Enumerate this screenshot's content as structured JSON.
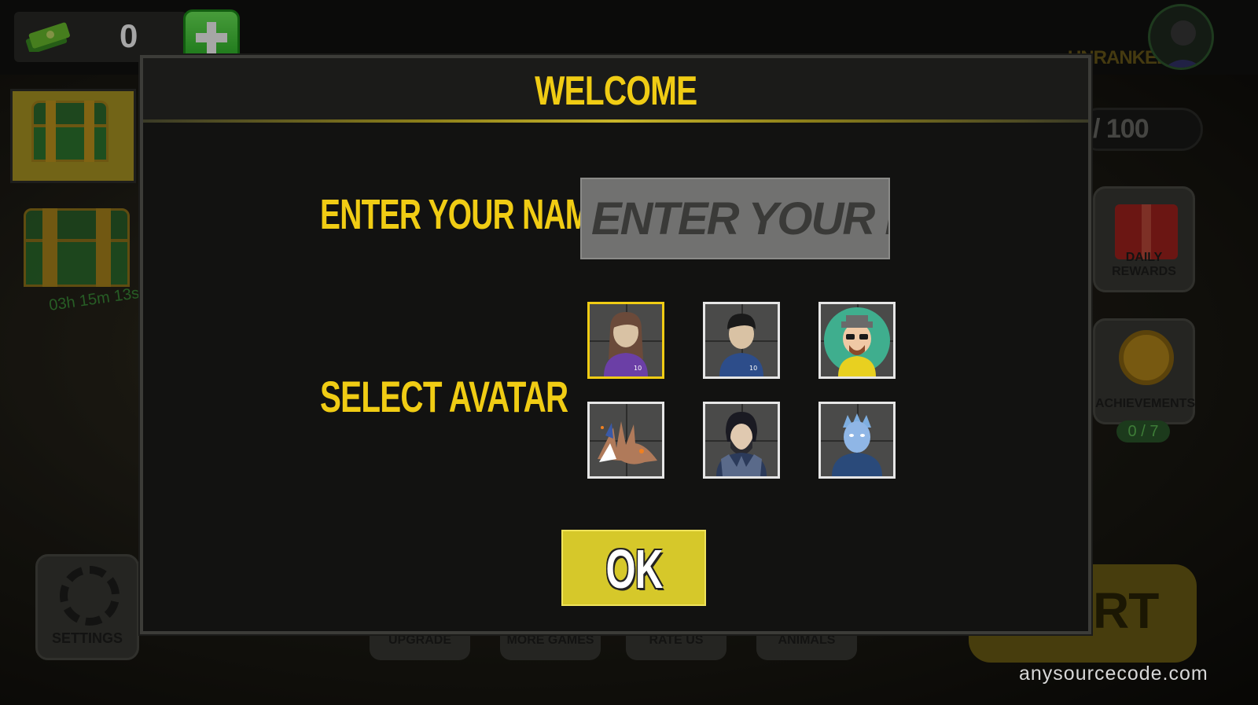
{
  "hud": {
    "cash_value": "0",
    "cash_icon": "money-stack-icon",
    "add_cash_icon": "plus-icon",
    "chest_timer": "03h 15m 13s",
    "rank_label": "UNRANKED",
    "xp_text": "/ 100",
    "daily_rewards_label": "DAILY REWARDS",
    "achievements_label": "ACHIEVEMENTS",
    "achievements_count": "0 / 7",
    "settings_label": "SETTINGS",
    "start_label": "RT",
    "bottom_tabs": [
      "UPGRADE",
      "MORE GAMES",
      "RATE US",
      "ANIMALS"
    ]
  },
  "dialog": {
    "title": "WELCOME",
    "name_label": "ENTER YOUR NAME",
    "name_placeholder": "ENTER YOUR NAME..",
    "name_value": "",
    "avatar_label": "SELECT AVATAR",
    "avatars": [
      {
        "name": "girl-avatar-icon",
        "selected": true
      },
      {
        "name": "boy-avatar-icon",
        "selected": false
      },
      {
        "name": "bald-man-glasses-avatar-icon",
        "selected": false
      },
      {
        "name": "dragon-avatar-icon",
        "selected": false
      },
      {
        "name": "bearded-warrior-avatar-icon",
        "selected": false
      },
      {
        "name": "ice-king-avatar-icon",
        "selected": false
      }
    ],
    "ok_label": "OK"
  },
  "watermark": "anysourcecode.com",
  "colors": {
    "accent_yellow": "#f0cc14",
    "ok_button": "#d6c82a",
    "add_green": "#27b324",
    "dialog_bg": "#121211"
  }
}
